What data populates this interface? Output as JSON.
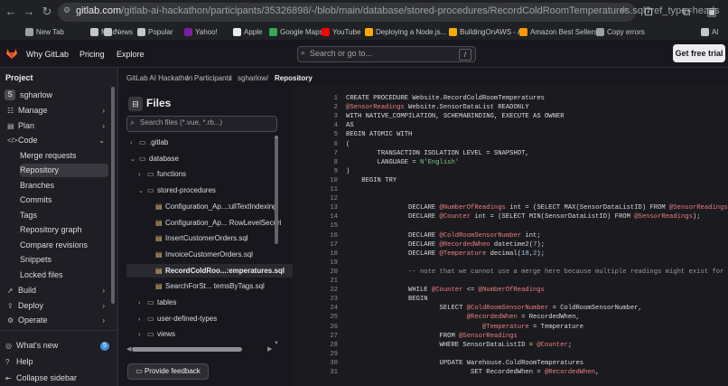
{
  "browser": {
    "url_host": "gitlab.com",
    "url_path": "/gitlab-ai-hackathon/participants/35326898/-/blob/main/database/stored-procedures/RecordColdRoomTemperatures.sql?ref_type=heads",
    "bookmarks": [
      {
        "label": "New Tab",
        "icon": "page-icon",
        "color": "#9aa0a6"
      },
      {
        "label": "Misc",
        "icon": "folder-icon",
        "color": "#c4c7c5"
      },
      {
        "label": "News",
        "icon": "folder-icon",
        "color": "#c4c7c5"
      },
      {
        "label": "Popular",
        "icon": "folder-icon",
        "color": "#c4c7c5"
      },
      {
        "label": "Yahoo!",
        "icon": "yahoo-icon",
        "color": "#7b1fa2"
      },
      {
        "label": "Apple",
        "icon": "apple-icon",
        "color": "#e8eaed"
      },
      {
        "label": "Google Maps",
        "icon": "maps-icon",
        "color": "#34a853"
      },
      {
        "label": "YouTube",
        "icon": "youtube-icon",
        "color": "#ff0000"
      },
      {
        "label": "Deploying a Node.js...",
        "icon": "site-icon",
        "color": "#f9ab00"
      },
      {
        "label": "BuildingOnAWS - A...",
        "icon": "site-icon",
        "color": "#f9ab00"
      },
      {
        "label": "Amazon Best Sellers...",
        "icon": "amazon-icon",
        "color": "#ff9900"
      },
      {
        "label": "Copy errors",
        "icon": "site-icon",
        "color": "#9aa0a6"
      },
      {
        "label": "Al",
        "icon": "folder-icon",
        "color": "#c4c7c5"
      }
    ]
  },
  "header": {
    "nav": [
      "Why GitLab",
      "Pricing",
      "Explore"
    ],
    "search_placeholder": "Search or go to...",
    "search_key": "/",
    "trial_button": "Get free trial"
  },
  "sidebar": {
    "section": "Project",
    "project_initial": "S",
    "project_name": "sgharlow",
    "items": [
      {
        "label": "Manage",
        "icon": "users-icon",
        "chevron": "›",
        "sub": false,
        "active": false
      },
      {
        "label": "Plan",
        "icon": "plan-icon",
        "chevron": "›",
        "sub": false,
        "active": false
      },
      {
        "label": "Code",
        "icon": "code-icon",
        "chevron": "⌄",
        "sub": false,
        "active": false
      },
      {
        "label": "Merge requests",
        "icon": "",
        "chevron": "",
        "sub": true,
        "active": false
      },
      {
        "label": "Repository",
        "icon": "",
        "chevron": "",
        "sub": true,
        "active": true
      },
      {
        "label": "Branches",
        "icon": "",
        "chevron": "",
        "sub": true,
        "active": false
      },
      {
        "label": "Commits",
        "icon": "",
        "chevron": "",
        "sub": true,
        "active": false
      },
      {
        "label": "Tags",
        "icon": "",
        "chevron": "",
        "sub": true,
        "active": false
      },
      {
        "label": "Repository graph",
        "icon": "",
        "chevron": "",
        "sub": true,
        "active": false
      },
      {
        "label": "Compare revisions",
        "icon": "",
        "chevron": "",
        "sub": true,
        "active": false
      },
      {
        "label": "Snippets",
        "icon": "",
        "chevron": "",
        "sub": true,
        "active": false
      },
      {
        "label": "Locked files",
        "icon": "",
        "chevron": "",
        "sub": true,
        "active": false
      },
      {
        "label": "Build",
        "icon": "rocket-icon",
        "chevron": "›",
        "sub": false,
        "active": false
      },
      {
        "label": "Deploy",
        "icon": "deploy-icon",
        "chevron": "›",
        "sub": false,
        "active": false
      },
      {
        "label": "Operate",
        "icon": "operate-icon",
        "chevron": "›",
        "sub": false,
        "active": false
      }
    ],
    "footer": [
      {
        "label": "What's new",
        "icon": "whatsnew-icon",
        "badge": "5"
      },
      {
        "label": "Help",
        "icon": "help-icon",
        "badge": ""
      },
      {
        "label": "Collapse sidebar",
        "icon": "collapse-icon",
        "badge": ""
      }
    ]
  },
  "breadcrumb": [
    "GitLab AI Hackathon",
    "Participants",
    "sgharlow",
    "Repository"
  ],
  "files": {
    "title": "Files",
    "search_placeholder": "Search files (*.vue, *.rb...)",
    "tree": [
      {
        "label": ".gitlab",
        "type": "folder",
        "caret": "›",
        "indent": 0,
        "selected": false
      },
      {
        "label": "database",
        "type": "folder",
        "caret": "⌄",
        "indent": 0,
        "selected": false
      },
      {
        "label": "functions",
        "type": "folder",
        "caret": "›",
        "indent": 1,
        "selected": false
      },
      {
        "label": "stored-procedures",
        "type": "folder",
        "caret": "⌄",
        "indent": 1,
        "selected": false
      },
      {
        "label": "Configuration_Ap...:ullTextIndexing",
        "type": "file",
        "caret": "",
        "indent": 2,
        "selected": false
      },
      {
        "label": "Configuration_Ap... RowLevelSecuri",
        "type": "file",
        "caret": "",
        "indent": 2,
        "selected": false
      },
      {
        "label": "InsertCustomerOrders.sql",
        "type": "file",
        "caret": "",
        "indent": 2,
        "selected": false
      },
      {
        "label": "InvoiceCustomerOrders.sql",
        "type": "file",
        "caret": "",
        "indent": 2,
        "selected": false
      },
      {
        "label": "RecordColdRoo...:emperatures.sql",
        "type": "file",
        "caret": "",
        "indent": 2,
        "selected": true
      },
      {
        "label": "SearchForSt... temsByTags.sql",
        "type": "file",
        "caret": "",
        "indent": 2,
        "selected": false
      },
      {
        "label": "tables",
        "type": "folder",
        "caret": "›",
        "indent": 1,
        "selected": false
      },
      {
        "label": "user-defined-types",
        "type": "folder",
        "caret": "›",
        "indent": 1,
        "selected": false
      },
      {
        "label": "views",
        "type": "folder",
        "caret": "›",
        "indent": 1,
        "selected": false
      }
    ],
    "feedback_button": "Provide feedback"
  },
  "code": {
    "lines": [
      {
        "n": "1",
        "t": "CREATE PROCEDURE Website.RecordColdRoomTemperatures"
      },
      {
        "n": "2",
        "t": "@SensorReadings Website.SensorDataList READONLY"
      },
      {
        "n": "3",
        "t": "WITH NATIVE_COMPILATION, SCHEMABINDING, EXECUTE AS OWNER"
      },
      {
        "n": "4",
        "t": "AS"
      },
      {
        "n": "5",
        "t": "BEGIN ATOMIC WITH"
      },
      {
        "n": "6",
        "t": "("
      },
      {
        "n": "7",
        "t": "        TRANSACTION ISOLATION LEVEL = SNAPSHOT,"
      },
      {
        "n": "8",
        "t": "        LANGUAGE = N'English'"
      },
      {
        "n": "9",
        "t": ")"
      },
      {
        "n": "10",
        "t": "    BEGIN TRY"
      },
      {
        "n": "11",
        "t": ""
      },
      {
        "n": "12",
        "t": ""
      },
      {
        "n": "13",
        "t": "                DECLARE @NumberOfReadings int = (SELECT MAX(SensorDataListID) FROM @SensorReadings"
      },
      {
        "n": "14",
        "t": "                DECLARE @Counter int = (SELECT MIN(SensorDataListID) FROM @SensorReadings);"
      },
      {
        "n": "15",
        "t": ""
      },
      {
        "n": "16",
        "t": "                DECLARE @ColdRoomSensorNumber int;"
      },
      {
        "n": "17",
        "t": "                DECLARE @RecordedWhen datetime2(7);"
      },
      {
        "n": "18",
        "t": "                DECLARE @Temperature decimal(18,2);"
      },
      {
        "n": "19",
        "t": ""
      },
      {
        "n": "20",
        "t": "                -- note that we cannot use a merge here because multiple readings might exist for"
      },
      {
        "n": "21",
        "t": ""
      },
      {
        "n": "22",
        "t": "                WHILE @Counter <= @NumberOfReadings"
      },
      {
        "n": "23",
        "t": "                BEGIN"
      },
      {
        "n": "24",
        "t": "                        SELECT @ColdRoomSensorNumber = ColdRoomSensorNumber,"
      },
      {
        "n": "25",
        "t": "                               @RecordedWhen = RecordedWhen,"
      },
      {
        "n": "26",
        "t": "                                   @Temperature = Temperature"
      },
      {
        "n": "27",
        "t": "                        FROM @SensorReadings"
      },
      {
        "n": "28",
        "t": "                        WHERE SensorDataListID = @Counter;"
      },
      {
        "n": "29",
        "t": ""
      },
      {
        "n": "30",
        "t": "                        UPDATE Warehouse.ColdRoomTemperatures"
      },
      {
        "n": "31",
        "t": "                                SET RecordedWhen = @RecordedWhen,"
      }
    ]
  }
}
